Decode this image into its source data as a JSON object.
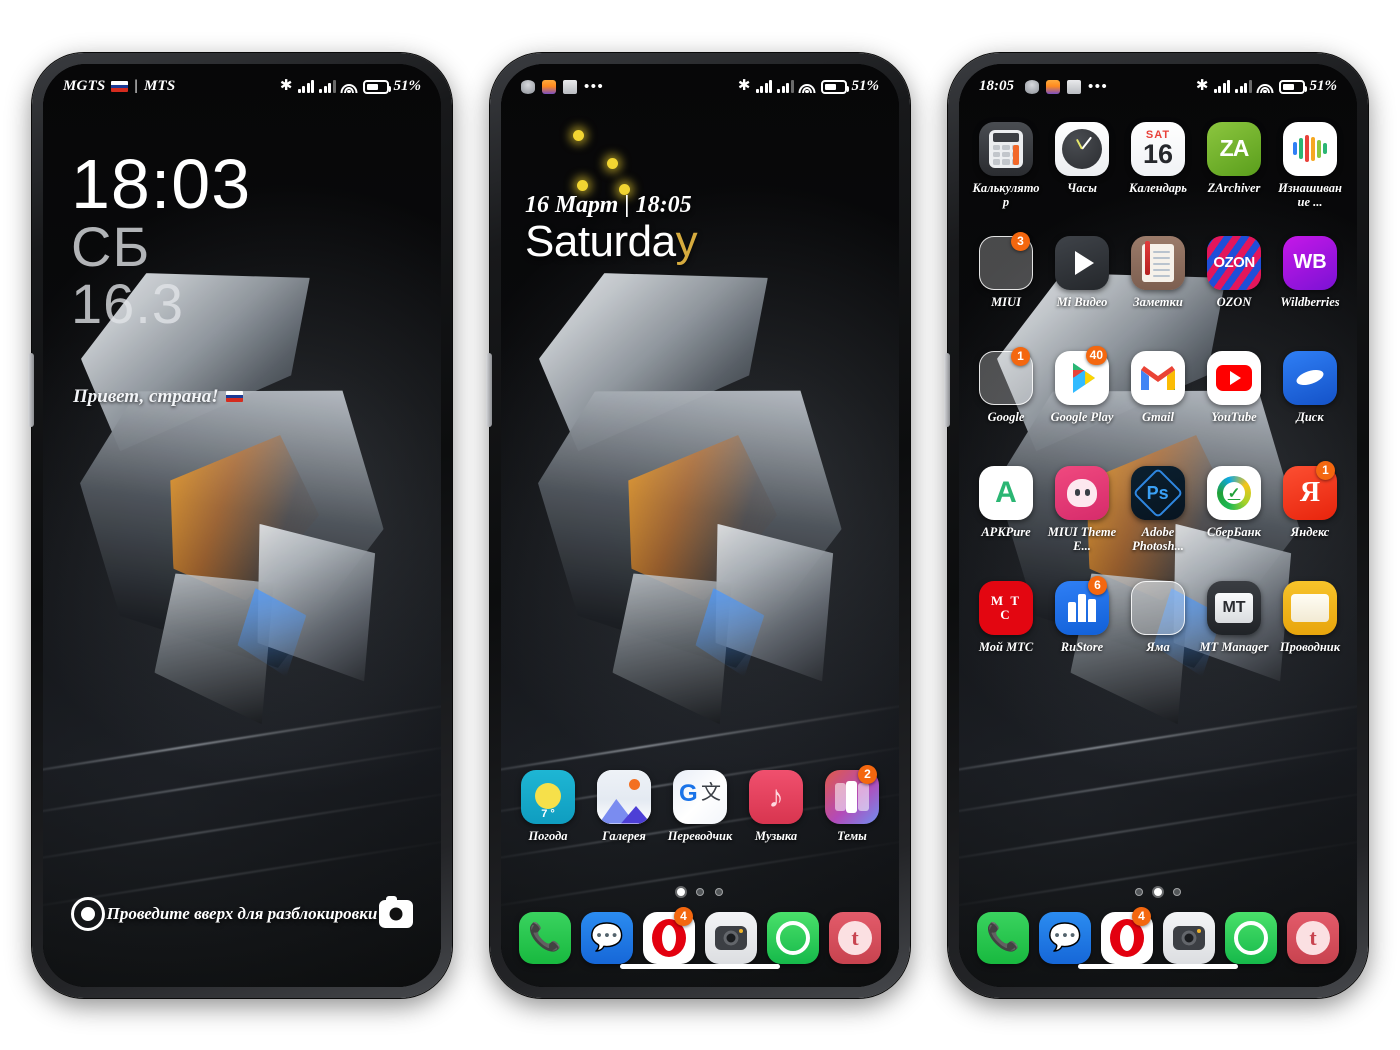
{
  "phones": [
    {
      "name": "lockscreen",
      "statusbar": {
        "carrier": "MGTS",
        "carrier2": "MTS",
        "separator": "|",
        "flag": "ru-flag-icon",
        "bluetooth_icon": "bluetooth-icon",
        "signal1_icon": "signal-bars-icon",
        "signal2_icon": "signal-bars-icon",
        "wifi_icon": "wifi-icon",
        "battery_icon": "battery-icon",
        "battery_pct": "51",
        "battery_unit": "%"
      },
      "clock": {
        "time": "18:03",
        "weekday": "СБ",
        "date": "16.3"
      },
      "greeting": "Привет, страна!",
      "unlock_hint": "Проведите вверх для разблокировки",
      "left_shortcut_icon": "assistant-ring-icon",
      "right_shortcut_icon": "camera-icon"
    },
    {
      "name": "homescreen-page-1",
      "statusbar": {
        "notif_icons": [
          "database-icon",
          "orange-app-icon",
          "printer-icon",
          "more-dots-icon"
        ],
        "bluetooth_icon": "bluetooth-icon",
        "signal1_icon": "signal-bars-icon",
        "signal2_icon": "signal-bars-icon",
        "wifi_icon": "wifi-icon",
        "battery_icon": "battery-icon",
        "battery_pct": "51",
        "battery_unit": "%"
      },
      "widget": {
        "line1": "16 Март | 18:05",
        "day_main": "Saturda",
        "day_accent": "y"
      },
      "apps": [
        {
          "label": "Погода",
          "icon": "weather-icon",
          "temp": "7 °",
          "badge": ""
        },
        {
          "label": "Галерея",
          "icon": "gallery-icon",
          "badge": ""
        },
        {
          "label": "Переводчик",
          "icon": "google-translate-icon",
          "badge": ""
        },
        {
          "label": "Музыка",
          "icon": "music-icon",
          "badge": ""
        },
        {
          "label": "Темы",
          "icon": "themes-icon",
          "badge": "2"
        }
      ],
      "page_dots": {
        "count": 3,
        "active": 0
      },
      "dock": [
        {
          "label": "Телефон",
          "icon": "phone-icon",
          "badge": ""
        },
        {
          "label": "Сообщения",
          "icon": "messages-icon",
          "badge": ""
        },
        {
          "label": "Opera",
          "icon": "opera-icon",
          "badge": "4"
        },
        {
          "label": "Камера",
          "icon": "camera-icon",
          "badge": ""
        },
        {
          "label": "WhatsApp",
          "icon": "whatsapp-icon",
          "badge": ""
        },
        {
          "label": "Tumblr",
          "icon": "tumblr-icon",
          "badge": ""
        }
      ]
    },
    {
      "name": "homescreen-page-2",
      "statusbar": {
        "time": "18:05",
        "notif_icons": [
          "database-icon",
          "orange-app-icon",
          "printer-icon",
          "more-dots-icon"
        ],
        "bluetooth_icon": "bluetooth-icon",
        "signal1_icon": "signal-bars-icon",
        "signal2_icon": "signal-bars-icon",
        "wifi_icon": "wifi-icon",
        "battery_icon": "battery-icon",
        "battery_pct": "51",
        "battery_unit": "%"
      },
      "grid": [
        [
          {
            "label": "Калькулятор",
            "icon": "calculator-icon",
            "badge": ""
          },
          {
            "label": "Часы",
            "icon": "clock-icon",
            "badge": ""
          },
          {
            "label": "Календарь",
            "icon": "calendar-icon",
            "cal_top": "SAT",
            "cal_num": "16",
            "badge": ""
          },
          {
            "label": "ZArchiver",
            "icon": "zarchiver-icon",
            "badge": ""
          },
          {
            "label": "Изнашивание ...",
            "icon": "zepp-life-icon",
            "badge": ""
          }
        ],
        [
          {
            "label": "MIUI",
            "icon": "folder-icon",
            "badge": "3"
          },
          {
            "label": "Mi Видео",
            "icon": "mi-video-icon",
            "badge": ""
          },
          {
            "label": "Заметки",
            "icon": "notes-icon",
            "badge": ""
          },
          {
            "label": "OZON",
            "icon": "ozon-icon",
            "badge": ""
          },
          {
            "label": "Wildberries",
            "icon": "wildberries-icon",
            "badge": ""
          }
        ],
        [
          {
            "label": "Google",
            "icon": "folder-icon",
            "badge": "1"
          },
          {
            "label": "Google Play",
            "icon": "google-play-icon",
            "badge": "40"
          },
          {
            "label": "Gmail",
            "icon": "gmail-icon",
            "badge": ""
          },
          {
            "label": "YouTube",
            "icon": "youtube-icon",
            "badge": ""
          },
          {
            "label": "Диск",
            "icon": "disk-icon",
            "badge": ""
          }
        ],
        [
          {
            "label": "APKPure",
            "icon": "apkpure-icon",
            "badge": ""
          },
          {
            "label": "MIUI Theme E...",
            "icon": "miui-theme-editor-icon",
            "badge": ""
          },
          {
            "label": "Adobe Photosh...",
            "icon": "photoshop-icon",
            "badge": ""
          },
          {
            "label": "СберБанк",
            "icon": "sberbank-icon",
            "badge": ""
          },
          {
            "label": "Яндекс",
            "icon": "yandex-icon",
            "badge": "1"
          }
        ],
        [
          {
            "label": "Мой МТС",
            "icon": "mts-icon",
            "badge": ""
          },
          {
            "label": "RuStore",
            "icon": "rustore-icon",
            "badge": "6"
          },
          {
            "label": "Яма",
            "icon": "folder-icon",
            "badge": ""
          },
          {
            "label": "MT Manager",
            "icon": "mt-manager-icon",
            "badge": ""
          },
          {
            "label": "Проводник",
            "icon": "file-explorer-icon",
            "badge": ""
          }
        ]
      ],
      "page_dots": {
        "count": 3,
        "active": 1
      },
      "dock": [
        {
          "label": "Телефон",
          "icon": "phone-icon",
          "badge": ""
        },
        {
          "label": "Сообщения",
          "icon": "messages-icon",
          "badge": ""
        },
        {
          "label": "Opera",
          "icon": "opera-icon",
          "badge": "4"
        },
        {
          "label": "Камера",
          "icon": "camera-icon",
          "badge": ""
        },
        {
          "label": "WhatsApp",
          "icon": "whatsapp-icon",
          "badge": ""
        },
        {
          "label": "Tumblr",
          "icon": "tumblr-icon",
          "badge": ""
        }
      ]
    }
  ],
  "colors": {
    "badge": "#f4670f",
    "accent_gold": "#d6ab3e",
    "mts_red": "#e30611"
  }
}
